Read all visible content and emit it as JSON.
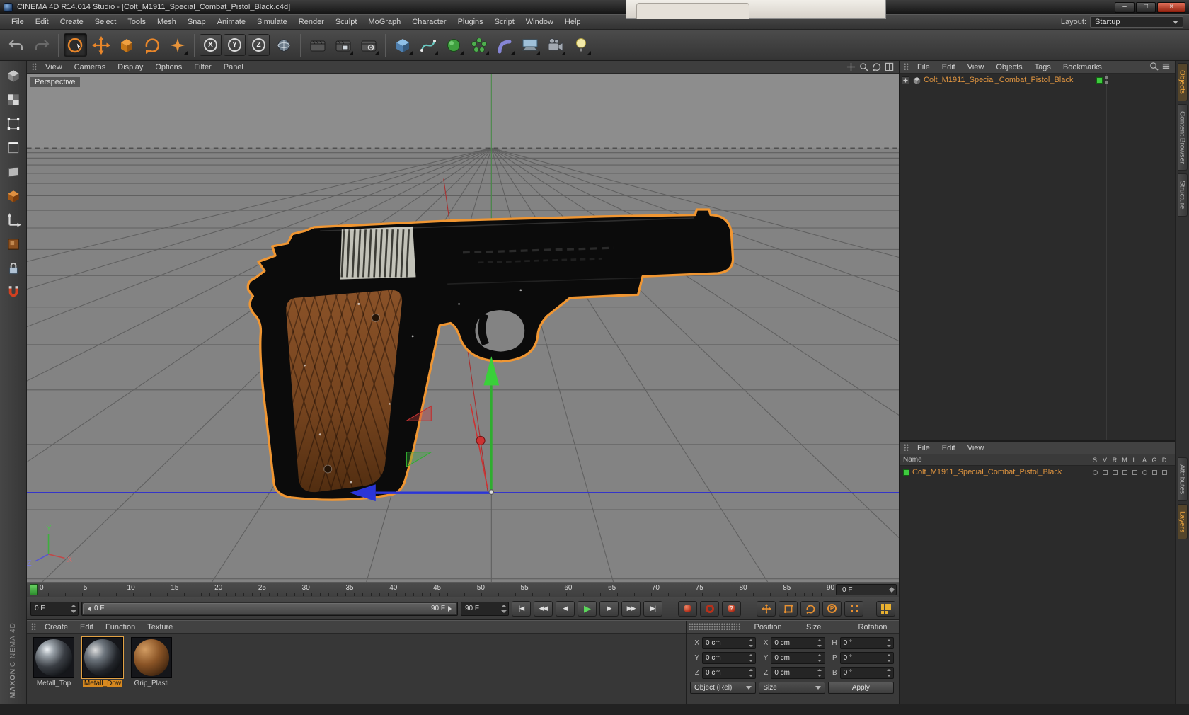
{
  "window": {
    "title": "CINEMA 4D R14.014 Studio - [Colt_M1911_Special_Combat_Pistol_Black.c4d]",
    "minimize_glyph": "–",
    "maximize_glyph": "□",
    "close_glyph": "×"
  },
  "menu_bar": {
    "items": [
      "File",
      "Edit",
      "Create",
      "Select",
      "Tools",
      "Mesh",
      "Snap",
      "Animate",
      "Simulate",
      "Render",
      "Sculpt",
      "MoGraph",
      "Character",
      "Plugins",
      "Script",
      "Window",
      "Help"
    ],
    "layout_label": "Layout:",
    "layout_value": "Startup"
  },
  "toolbar": {
    "axis_locks": [
      "X",
      "Y",
      "Z"
    ]
  },
  "viewport": {
    "menu": [
      "View",
      "Cameras",
      "Display",
      "Options",
      "Filter",
      "Panel"
    ],
    "label": "Perspective",
    "axis_labels": {
      "x": "X",
      "y": "Y",
      "z": "Z"
    }
  },
  "object_manager": {
    "menu": [
      "File",
      "Edit",
      "View",
      "Objects",
      "Tags",
      "Bookmarks"
    ],
    "object_name": "Colt_M1911_Special_Combat_Pistol_Black"
  },
  "layer_manager": {
    "menu": [
      "File",
      "Edit",
      "View"
    ],
    "name_header": "Name",
    "columns": [
      "S",
      "V",
      "R",
      "M",
      "L",
      "A",
      "G",
      "D"
    ],
    "object_name": "Colt_M1911_Special_Combat_Pistol_Black"
  },
  "right_tabs": {
    "objects": "Objects",
    "content_browser": "Content Browser",
    "structure": "Structure",
    "attributes": "Attributes",
    "layers": "Layers"
  },
  "timeline": {
    "ticks": [
      "0",
      "5",
      "10",
      "15",
      "20",
      "25",
      "30",
      "35",
      "40",
      "45",
      "50",
      "55",
      "60",
      "65",
      "70",
      "75",
      "80",
      "85",
      "90"
    ],
    "ruler_frame": "0 F",
    "current_frame": "0 F",
    "range_left": "0 F",
    "range_right": "90 F",
    "end_frame": "90 F"
  },
  "playback": {
    "buttons": [
      {
        "name": "goto-start",
        "glyph": "|◀"
      },
      {
        "name": "prev-key",
        "glyph": "◀◀"
      },
      {
        "name": "prev-frame",
        "glyph": "◀"
      },
      {
        "name": "play",
        "glyph": "▶"
      },
      {
        "name": "next-frame",
        "glyph": "▶"
      },
      {
        "name": "next-key",
        "glyph": "▶▶"
      },
      {
        "name": "goto-end",
        "glyph": "▶|"
      }
    ]
  },
  "materials": {
    "menu": [
      "Create",
      "Edit",
      "Function",
      "Texture"
    ],
    "items": [
      {
        "name": "Metall_Top"
      },
      {
        "name": "Metall_Dow"
      },
      {
        "name": "Grip_Plasti"
      }
    ]
  },
  "coordinates": {
    "groups": [
      "Position",
      "Size",
      "Rotation"
    ],
    "position": {
      "labels": [
        "X",
        "Y",
        "Z"
      ],
      "values": [
        "0 cm",
        "0 cm",
        "0 cm"
      ]
    },
    "size": {
      "labels": [
        "X",
        "Y",
        "Z"
      ],
      "values": [
        "0 cm",
        "0 cm",
        "0 cm"
      ]
    },
    "rotation": {
      "labels": [
        "H",
        "P",
        "B"
      ],
      "values": [
        "0 °",
        "0 °",
        "0 °"
      ]
    },
    "object_mode": "Object (Rel)",
    "size_mode": "Size",
    "apply_label": "Apply"
  },
  "icons": {
    "parameter_key": "P"
  },
  "branding": {
    "maxon": "MAXON",
    "cinema": "CINEMA 4D"
  }
}
